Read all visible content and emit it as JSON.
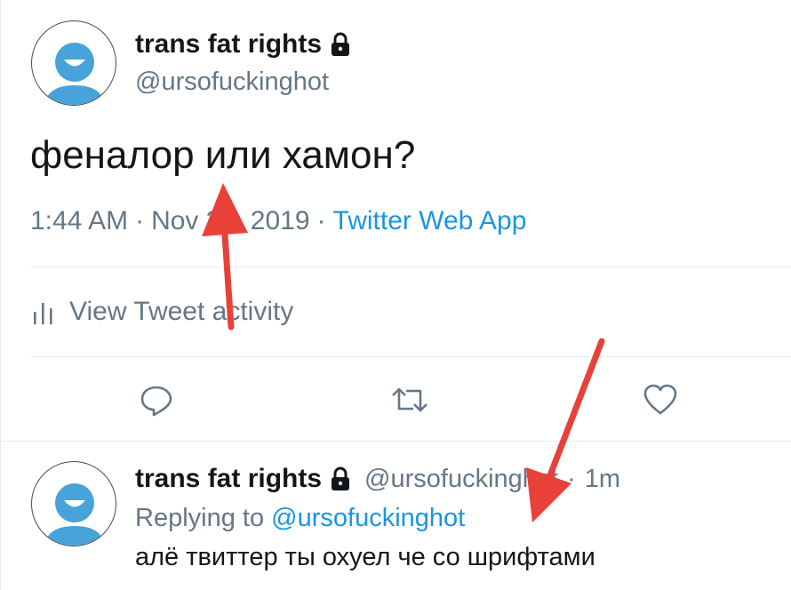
{
  "tweet": {
    "display_name": "trans fat rights",
    "handle": "@ursofuckinghot",
    "text": "феналор или хамон?",
    "time": "1:44 AM",
    "separator": "·",
    "date": "Nov 30, 2019",
    "source": "Twitter Web App",
    "activity_label": "View Tweet activity"
  },
  "actions": {
    "reply_icon": "reply-icon",
    "retweet_icon": "retweet-icon",
    "like_icon": "heart-icon"
  },
  "reply": {
    "display_name": "trans fat rights",
    "handle": "@ursofuckinghot",
    "separator": "·",
    "age": "1m",
    "replying_prefix": "Replying to",
    "replying_to": "@ursofuckinghot",
    "text": "алё твиттер ты охуел че со шрифтами"
  },
  "colors": {
    "accent": "#1b95e0",
    "secondary_text": "#657786",
    "annotation_arrow": "#e8413a",
    "avatar_blue": "#47a3d9"
  }
}
